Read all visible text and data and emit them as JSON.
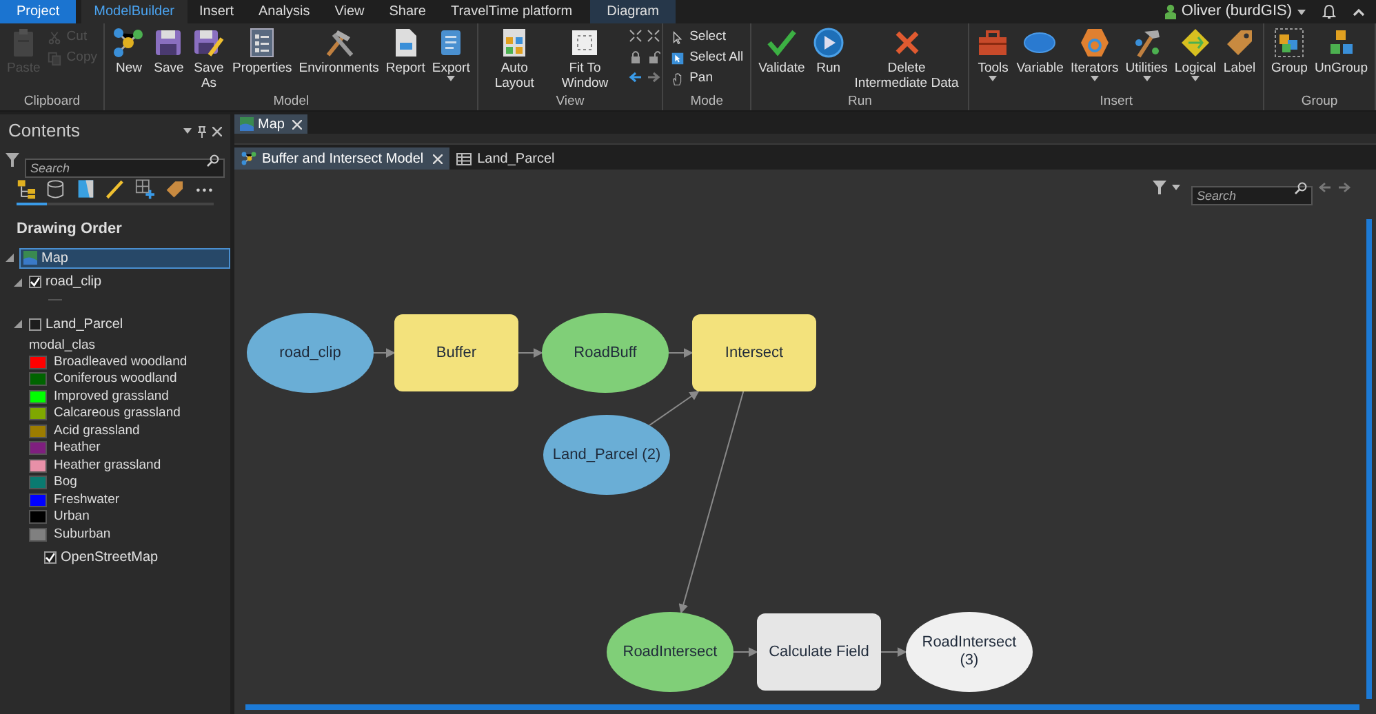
{
  "app_tabs": [
    {
      "label": "Project",
      "kind": "file",
      "selected": false
    },
    {
      "label": "ModelBuilder",
      "kind": "normal",
      "selected": true
    },
    {
      "label": "Insert",
      "kind": "normal",
      "selected": false
    },
    {
      "label": "Analysis",
      "kind": "normal",
      "selected": false
    },
    {
      "label": "View",
      "kind": "normal",
      "selected": false
    },
    {
      "label": "Share",
      "kind": "normal",
      "selected": false
    },
    {
      "label": "TravelTime platform",
      "kind": "normal",
      "selected": false
    },
    {
      "label": "Diagram",
      "kind": "contextual",
      "selected": false
    }
  ],
  "user": {
    "name": "Oliver (burdGIS)"
  },
  "ribbon": [
    {
      "label": "Clipboard",
      "commands": [
        {
          "label": "Paste",
          "kind": "large",
          "disabled": true
        },
        {
          "label": "Cut",
          "kind": "small",
          "disabled": true
        },
        {
          "label": "Copy",
          "kind": "small",
          "disabled": true
        }
      ]
    },
    {
      "label": "Model",
      "commands": [
        {
          "label": "New",
          "kind": "large",
          "disabled": false
        },
        {
          "label": "Save",
          "kind": "large",
          "disabled": false
        },
        {
          "label": "Save As",
          "kind": "large",
          "disabled": false
        },
        {
          "label": "Properties",
          "kind": "large",
          "disabled": false
        },
        {
          "label": "Environments",
          "kind": "large",
          "disabled": false
        },
        {
          "label": "Report",
          "kind": "large",
          "disabled": false
        },
        {
          "label": "Export",
          "kind": "large",
          "disabled": false,
          "dropdown": true
        }
      ]
    },
    {
      "label": "View",
      "commands": [
        {
          "label": "Auto Layout",
          "kind": "large",
          "disabled": false
        },
        {
          "label": "Fit To Window",
          "kind": "large",
          "disabled": false
        },
        {
          "kind": "icon_grid"
        }
      ]
    },
    {
      "label": "Mode",
      "commands": [
        {
          "label": "Select",
          "kind": "small",
          "disabled": false
        },
        {
          "label": "Select All",
          "kind": "small",
          "disabled": false
        },
        {
          "label": "Pan",
          "kind": "small",
          "disabled": false
        }
      ]
    },
    {
      "label": "Run",
      "commands": [
        {
          "label": "Validate",
          "kind": "large",
          "disabled": false
        },
        {
          "label": "Run",
          "kind": "large",
          "disabled": false
        },
        {
          "label": "Delete Intermediate Data",
          "kind": "large",
          "disabled": false
        }
      ]
    },
    {
      "label": "Insert",
      "commands": [
        {
          "label": "Tools",
          "kind": "large",
          "disabled": false,
          "dropdown": true
        },
        {
          "label": "Variable",
          "kind": "large",
          "disabled": false
        },
        {
          "label": "Iterators",
          "kind": "large",
          "disabled": false,
          "dropdown": true
        },
        {
          "label": "Utilities",
          "kind": "large",
          "disabled": false,
          "dropdown": true
        },
        {
          "label": "Logical",
          "kind": "large",
          "disabled": false,
          "dropdown": true
        },
        {
          "label": "Label",
          "kind": "large",
          "disabled": false
        }
      ]
    },
    {
      "label": "Group",
      "commands": [
        {
          "label": "Group",
          "kind": "large",
          "disabled": false
        },
        {
          "label": "UnGroup",
          "kind": "large",
          "disabled": false
        }
      ]
    }
  ],
  "contents": {
    "title": "Contents",
    "search_placeholder": "Search",
    "heading": "Drawing Order",
    "layers": [
      {
        "name": "Map",
        "kind": "map",
        "selected": true,
        "expanded": true,
        "children": [
          {
            "name": "road_clip",
            "kind": "line_layer",
            "selected": false,
            "expanded": true,
            "checked": true
          },
          {
            "name": "Land_Parcel",
            "kind": "polygon_layer",
            "selected": false,
            "expanded": true,
            "checked": false,
            "field": "modal_clas",
            "classes": [
              {
                "label": "Broadleaved woodland",
                "color": "#ff0000"
              },
              {
                "label": "Coniferous woodland",
                "color": "#006400"
              },
              {
                "label": "Improved grassland",
                "color": "#00ff00"
              },
              {
                "label": "Calcareous grassland",
                "color": "#7fa800"
              },
              {
                "label": "Acid grassland",
                "color": "#9c7c00"
              },
              {
                "label": "Heather",
                "color": "#7f1f7f"
              },
              {
                "label": "Heather grassland",
                "color": "#e890a8"
              },
              {
                "label": "Bog",
                "color": "#0a7a70"
              },
              {
                "label": "Freshwater",
                "color": "#0000ff"
              },
              {
                "label": "Urban",
                "color": "#000000"
              },
              {
                "label": "Suburban",
                "color": "#808080"
              }
            ]
          },
          {
            "name": "OpenStreetMap",
            "kind": "basemap",
            "selected": false,
            "checked": true
          }
        ]
      }
    ]
  },
  "map_tab": {
    "label": "Map",
    "selected": true
  },
  "view_tabs": [
    {
      "label": "Buffer and Intersect Model",
      "kind": "model",
      "selected": true
    },
    {
      "label": "Land_Parcel",
      "kind": "table",
      "selected": false
    }
  ],
  "canvas": {
    "search_placeholder": "Search",
    "nodes": [
      {
        "label": "road_clip",
        "kind": "data",
        "color": "#6aaed6"
      },
      {
        "label": "Buffer",
        "kind": "tool",
        "color": "#f3e27c"
      },
      {
        "label": "RoadBuff",
        "kind": "data",
        "color": "#80cf78"
      },
      {
        "label": "Intersect",
        "kind": "tool",
        "color": "#f3e27c"
      },
      {
        "label": "Land_Parcel (2)",
        "kind": "data",
        "color": "#6aaed6"
      },
      {
        "label": "RoadIntersect",
        "kind": "data",
        "color": "#80cf78"
      },
      {
        "label": "Calculate Field",
        "kind": "tool",
        "color": "#e6e6e6"
      },
      {
        "label": "RoadIntersect (3)",
        "kind": "data",
        "color": "#f0f0f0"
      }
    ]
  }
}
